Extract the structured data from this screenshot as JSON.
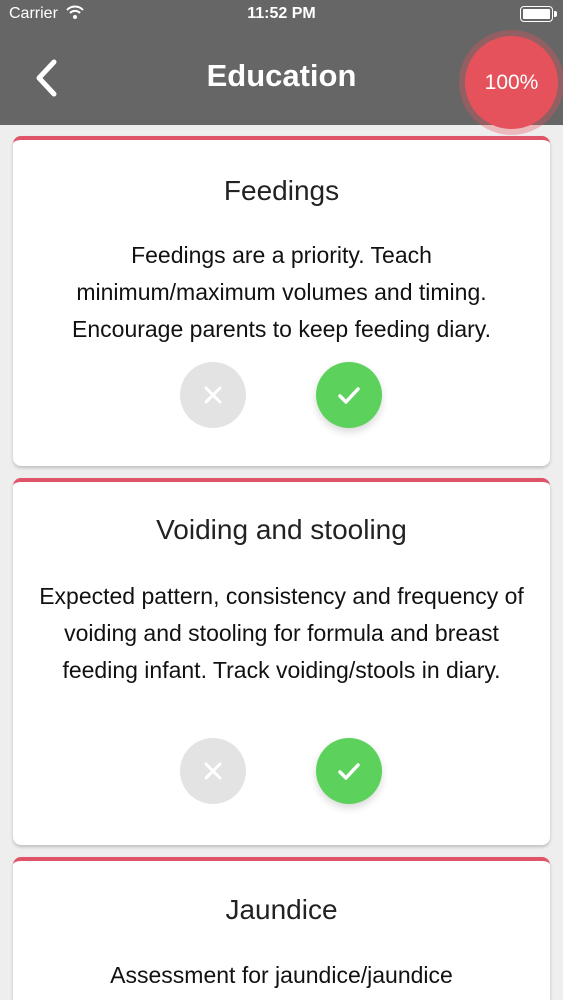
{
  "status": {
    "carrier": "Carrier",
    "time": "11:52 PM"
  },
  "nav": {
    "title": "Education",
    "progress": "100%"
  },
  "cards": [
    {
      "title": "Feedings",
      "text": "Feedings are a priority. Teach minimum/maximum volumes and timing. Encourage parents to keep feeding diary."
    },
    {
      "title": "Voiding and stooling",
      "text": "Expected pattern, consistency and frequency of voiding and stooling for formula and breast feeding infant. Track voiding/stools in diary."
    },
    {
      "title": "Jaundice",
      "text": "Assessment for jaundice/jaundice"
    }
  ],
  "colors": {
    "accent": "#e0546a",
    "progress_badge": "#e6525c",
    "confirm": "#5cd15c",
    "dismiss": "#e3e3e3",
    "header": "#666666"
  },
  "icons": {
    "back": "chevron-left-icon",
    "wifi": "wifi-icon",
    "battery": "battery-icon",
    "dismiss": "x-icon",
    "confirm": "check-icon"
  }
}
